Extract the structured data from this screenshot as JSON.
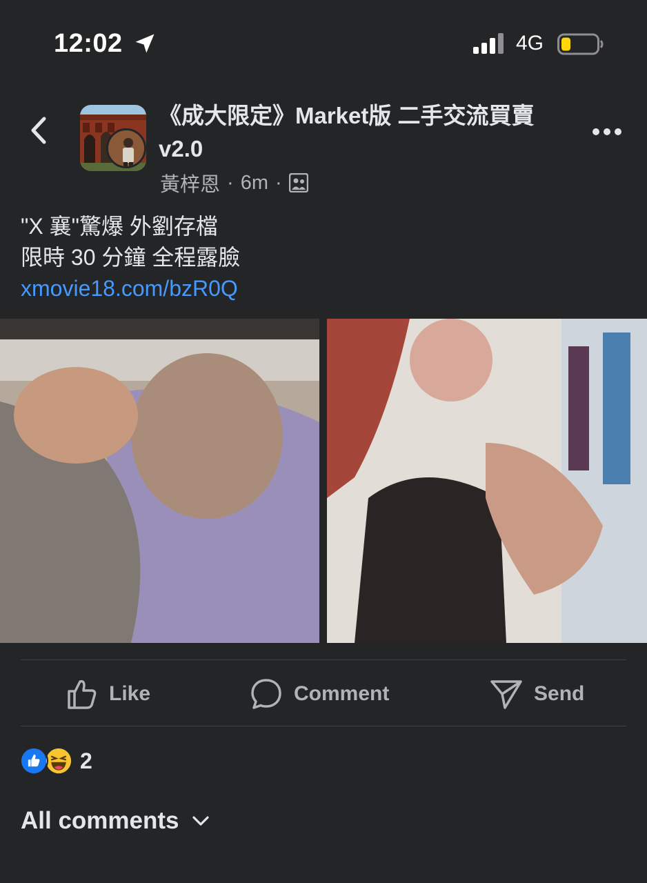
{
  "status_bar": {
    "time": "12:02",
    "network": "4G",
    "icons": [
      "location-arrow-icon",
      "cellular-signal-icon",
      "battery-low-icon"
    ]
  },
  "post": {
    "group_name": "《成大限定》Market版 二手交流買賣 v2.0",
    "author": "黃梓恩",
    "separator": "·",
    "time_ago": "6m",
    "text_line1": "\"X 襄\"驚爆 外劉存檔",
    "text_line2": "限時 30 分鐘 全程露臉",
    "link": "xmovie18.com/bzR0Q"
  },
  "actions": {
    "like": "Like",
    "comment": "Comment",
    "send": "Send"
  },
  "reactions": {
    "count": "2",
    "types": [
      "like-reaction-icon",
      "haha-reaction-icon"
    ]
  },
  "comments": {
    "filter_label": "All comments"
  },
  "colors": {
    "background": "#242526",
    "text_primary": "#e4e6eb",
    "text_secondary": "#b0b3b8",
    "link": "#4599ff",
    "battery_fill": "#ffd60a",
    "like_blue": "#1877f2"
  }
}
